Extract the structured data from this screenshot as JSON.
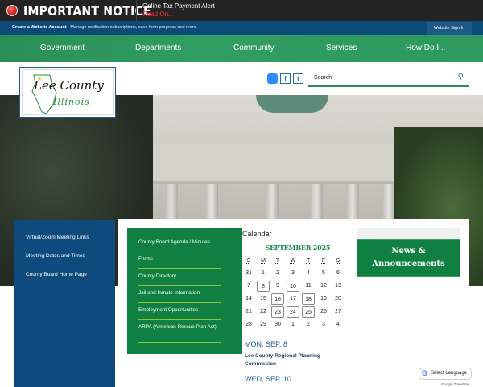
{
  "notice": {
    "title": "IMPORTANT NOTICE",
    "alert_title": "Online Tax Payment Alert",
    "alert_link": "Read On..."
  },
  "account_bar": {
    "create_label": "Create a Website Account",
    "message": " - Manage notification subscriptions, save form progress and more.",
    "sign_in": "Website Sign In"
  },
  "nav": [
    "Government",
    "Departments",
    "Community",
    "Services",
    "How Do I..."
  ],
  "logo": {
    "line1": "Lee County",
    "line2": "Illinois"
  },
  "social": {
    "facebook": "f",
    "twitter": "t"
  },
  "search": {
    "placeholder": "Search"
  },
  "left_links": [
    "Virtual/Zoom Meeting Links",
    "Meeting Dates and Times",
    "County Board Home Page"
  ],
  "quick_links": [
    "County Board Agenda / Minutes",
    "Forms",
    "County Directory",
    "Jail and Inmate Information",
    "Employment Opportunities",
    "ARPA (American Rescue Plan Act)"
  ],
  "calendar": {
    "heading": "Calendar",
    "month": "SEPTEMBER 2025",
    "dow": [
      "S",
      "M",
      "T",
      "W",
      "T",
      "F",
      "S"
    ],
    "weeks": [
      [
        "31",
        "1",
        "2",
        "3",
        "4",
        "5",
        "6"
      ],
      [
        "7",
        "8",
        "9",
        "10",
        "11",
        "12",
        "13"
      ],
      [
        "14",
        "15",
        "16",
        "17",
        "18",
        "19",
        "20"
      ],
      [
        "21",
        "22",
        "23",
        "24",
        "25",
        "26",
        "27"
      ],
      [
        "28",
        "29",
        "30",
        "1",
        "2",
        "3",
        "4"
      ]
    ],
    "event_days": [
      "8",
      "10",
      "16",
      "18",
      "23",
      "24",
      "25"
    ],
    "events": [
      {
        "date": "MON, SEP. 8",
        "title": "Lee County Regional Planning Commission"
      },
      {
        "date": "WED, SEP. 10"
      }
    ]
  },
  "news": {
    "line1": "News &",
    "line2": "Announcements"
  },
  "translate": {
    "select": "Select Language",
    "powered": "Google Translate"
  }
}
